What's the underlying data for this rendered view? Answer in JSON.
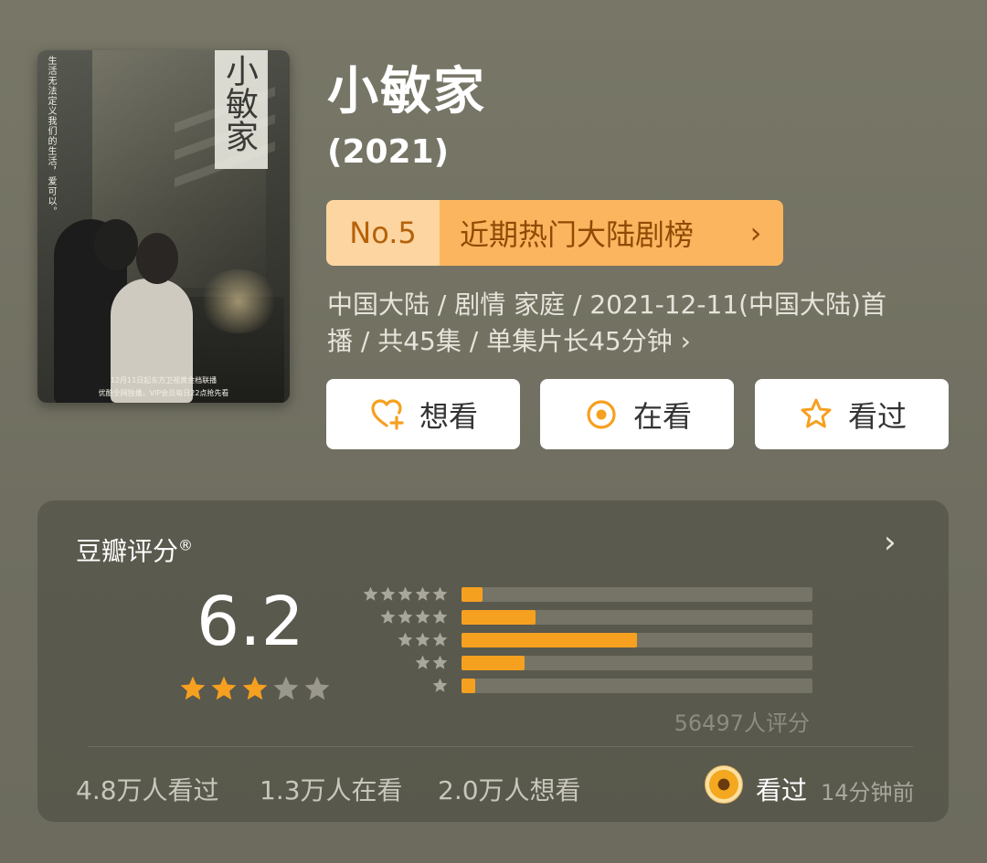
{
  "poster": {
    "vertical_caption": "生活无法定义我们的生活，爱可以。",
    "title_art": "小敏家",
    "bottom_line_1": "12月11日起东方卫视黄金档联播",
    "bottom_line_2": "优酷全网独播，VIP会员每日22点抢先看"
  },
  "header": {
    "title": "小敏家",
    "year": "(2021)",
    "rank": {
      "number": "No.5",
      "label": "近期热门大陆剧榜",
      "chevron": "›"
    },
    "meta_line_1": "中国大陆 / 剧情 家庭 / 2021-12-11(中国大陆)首",
    "meta_line_2": "播 / 共45集 / 单集片长45分钟",
    "meta_chevron": "›"
  },
  "actions": [
    {
      "label": "想看",
      "icon": "heart-plus-icon"
    },
    {
      "label": "在看",
      "icon": "target-circle-icon"
    },
    {
      "label": "看过",
      "icon": "star-outline-icon"
    }
  ],
  "rating": {
    "title": "豆瓣评分",
    "registered_mark": "®",
    "chevron": "›",
    "score": "6.2",
    "star_fill": 3,
    "star_total": 5,
    "distribution": [
      {
        "stars": 5,
        "fraction": 0.06
      },
      {
        "stars": 4,
        "fraction": 0.21
      },
      {
        "stars": 3,
        "fraction": 0.5
      },
      {
        "stars": 2,
        "fraction": 0.18
      },
      {
        "stars": 1,
        "fraction": 0.04
      }
    ],
    "rating_count": "56497人评分",
    "stats": [
      "4.8万人看过",
      "1.3万人在看",
      "2.0万人想看"
    ],
    "user_status": "看过",
    "user_time": "14分钟前"
  },
  "colors": {
    "accent": "#f6a020",
    "rank_badge_light": "#fcd5a0",
    "rank_badge": "#fcb55f",
    "star_filled": "#f6a020",
    "star_empty": "#9a988c"
  }
}
